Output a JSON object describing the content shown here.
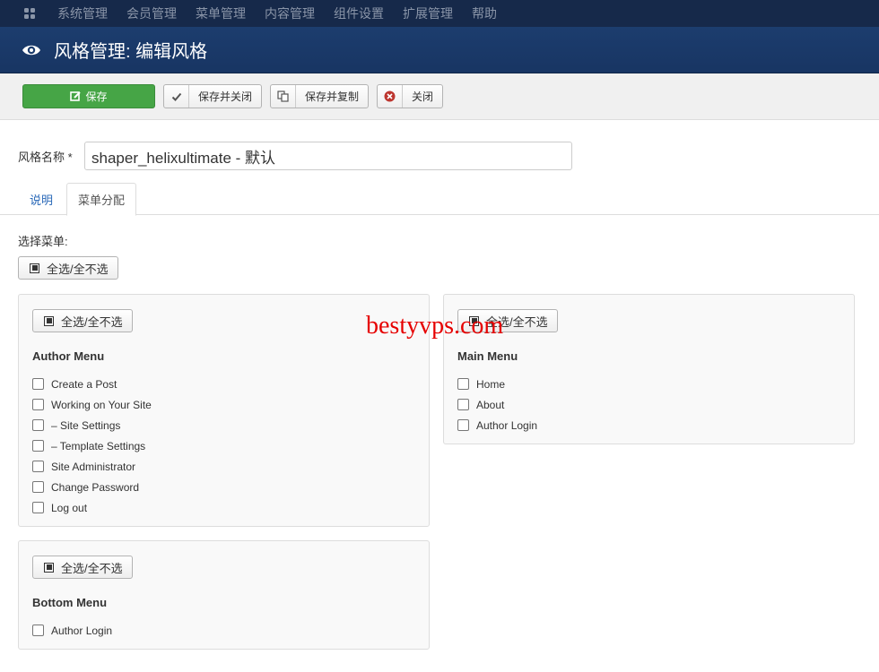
{
  "topnav": {
    "items": [
      "系统管理",
      "会员管理",
      "菜单管理",
      "内容管理",
      "组件设置",
      "扩展管理",
      "帮助"
    ]
  },
  "header": {
    "title": "风格管理: 编辑风格"
  },
  "toolbar": {
    "save": "保存",
    "save_close": "保存并关闭",
    "save_copy": "保存并复制",
    "close": "关闭"
  },
  "form": {
    "style_name_label": "风格名称 *",
    "style_name_value": "shaper_helixultimate - 默认"
  },
  "tabs": [
    "说明",
    "菜单分配"
  ],
  "assignment": {
    "select_menu_label": "选择菜单:",
    "toggle_all_label": "全选/全不选",
    "menus": [
      {
        "title": "Author Menu",
        "items": [
          "Create a Post",
          "Working on Your Site",
          "– Site Settings",
          "– Template Settings",
          "Site Administrator",
          "Change Password",
          "Log out"
        ]
      },
      {
        "title": "Main Menu",
        "items": [
          "Home",
          "About",
          "Author Login"
        ]
      },
      {
        "title": "Bottom Menu",
        "items": [
          "Author Login"
        ]
      }
    ]
  },
  "watermark": "bestyvps.com",
  "colors": {
    "topnav_bg": "#16294a",
    "header_bg": "#1c3d6e",
    "save_green": "#46a546",
    "tab_link": "#2a69b8",
    "watermark_red": "#e60000"
  }
}
